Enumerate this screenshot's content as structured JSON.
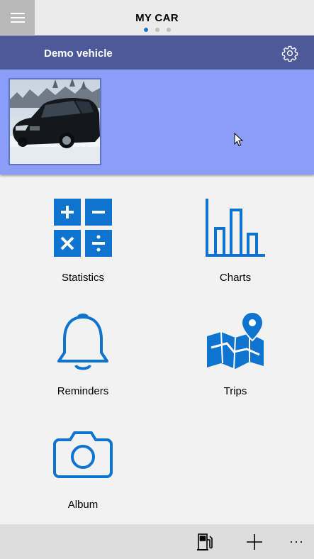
{
  "header": {
    "title": "MY CAR",
    "pages": 3,
    "active_page": 1
  },
  "vehicle": {
    "name": "Demo vehicle"
  },
  "tiles": [
    {
      "label": "Statistics",
      "icon": "calculator-icon"
    },
    {
      "label": "Charts",
      "icon": "bar-chart-icon"
    },
    {
      "label": "Reminders",
      "icon": "bell-icon"
    },
    {
      "label": "Trips",
      "icon": "map-pin-icon"
    },
    {
      "label": "Album",
      "icon": "camera-icon"
    }
  ],
  "bottombar": {
    "more_label": "···"
  },
  "colors": {
    "accent": "#1f78c8",
    "vehicle_bar": "#4d5a9a",
    "hero": "#8a9ef8",
    "icon_blue": "#0f74d0"
  }
}
